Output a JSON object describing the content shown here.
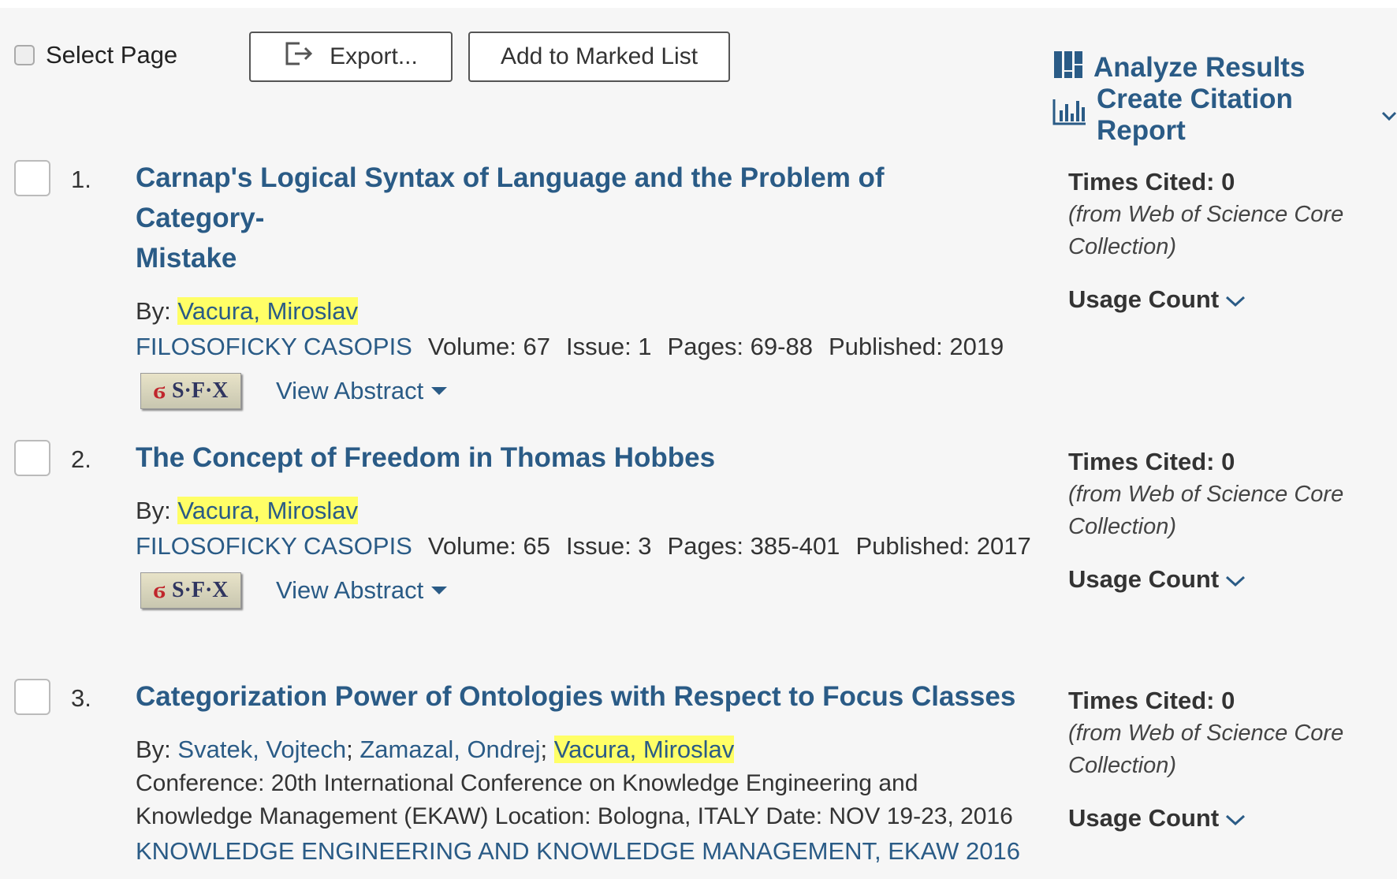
{
  "toolbar": {
    "select_page_label": "Select Page",
    "export_label": "Export...",
    "marked_list_label": "Add to Marked List",
    "analyze_label": "Analyze Results",
    "citation_label": "Create Citation Report"
  },
  "records": [
    {
      "number": "1.",
      "title_line1": "Carnap's Logical Syntax of Language and the Problem of Category-",
      "title_line2": "Mistake",
      "by_label": "By:",
      "author_1": "Vacura, Miroslav",
      "journal": "FILOSOFICKY CASOPIS",
      "volume": "Volume: 67",
      "issue": "Issue: 1",
      "pages": "Pages: 69-88",
      "published": "Published: 2019",
      "sfx_text": "S·F·X",
      "view_abstract": "View Abstract",
      "times_cited": "Times Cited: 0",
      "from_line1": "(from Web of Science Core",
      "from_line2": "Collection)",
      "usage_count": "Usage Count"
    },
    {
      "number": "2.",
      "title_line1": "The Concept of Freedom in Thomas Hobbes",
      "by_label": "By:",
      "author_1": "Vacura, Miroslav",
      "journal": "FILOSOFICKY CASOPIS",
      "volume": "Volume: 65",
      "issue": "Issue: 3",
      "pages": "Pages: 385-401",
      "published": "Published: 2017",
      "sfx_text": "S·F·X",
      "view_abstract": "View Abstract",
      "times_cited": "Times Cited: 0",
      "from_line1": "(from Web of Science Core",
      "from_line2": "Collection)",
      "usage_count": "Usage Count"
    },
    {
      "number": "3.",
      "title_line1": "Categorization Power of Ontologies with Respect to Focus Classes",
      "by_label": "By:",
      "author_1": "Svatek, Vojtech",
      "author_2": "Zamazal, Ondrej",
      "author_3": "Vacura, Miroslav",
      "conference_line1": "Conference: 20th International Conference on Knowledge Engineering and",
      "conference_line2": "Knowledge Management (EKAW) Location: Bologna, ITALY Date: NOV 19-23, 2016",
      "journal": "KNOWLEDGE ENGINEERING AND KNOWLEDGE MANAGEMENT, EKAW 2016",
      "times_cited": "Times Cited: 0",
      "from_line1": "(from Web of Science Core",
      "from_line2": "Collection)",
      "usage_count": "Usage Count"
    }
  ],
  "colors": {
    "link": "#2a5b86",
    "highlight": "#ffff66",
    "background": "#f6f6f6"
  }
}
